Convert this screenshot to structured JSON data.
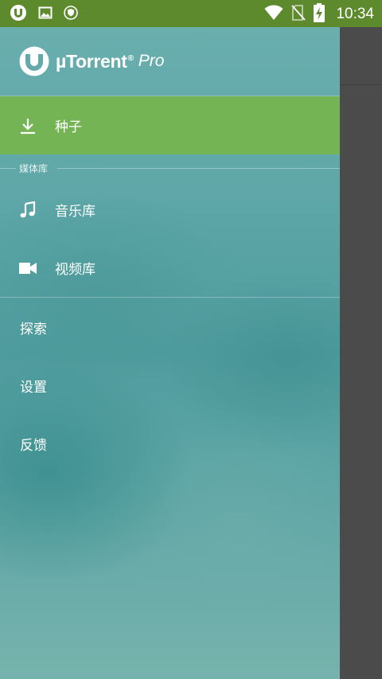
{
  "status_bar": {
    "time": "10:34",
    "left_icons": [
      "utorrent-notification-icon",
      "image-notification-icon",
      "shield-notification-icon"
    ],
    "right_icons": [
      "wifi-icon",
      "no-sim-icon",
      "battery-charging-icon"
    ],
    "background_color": "#5e8a2e"
  },
  "app": {
    "brand": "µTorrent",
    "brand_suffix": "Pro",
    "registered_mark": "®"
  },
  "drawer": {
    "active_item": {
      "label": "种子",
      "icon": "download-icon"
    },
    "media_section_title": "媒体库",
    "media_items": [
      {
        "label": "音乐库",
        "icon": "music-note-icon"
      },
      {
        "label": "视频库",
        "icon": "video-camera-icon"
      }
    ],
    "other_items": [
      {
        "label": "探索"
      },
      {
        "label": "设置"
      },
      {
        "label": "反馈"
      }
    ],
    "accent_color": "#74b454"
  }
}
